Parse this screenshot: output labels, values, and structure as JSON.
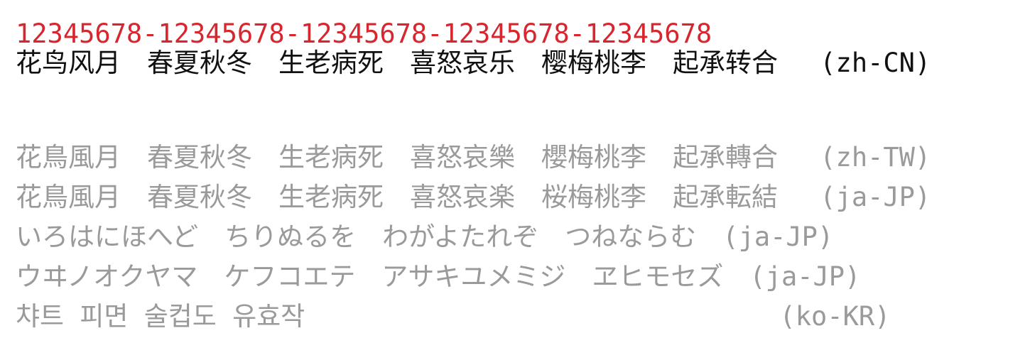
{
  "ruler": "12345678-12345678-12345678-12345678-12345678",
  "lines": [
    {
      "text": "花鸟风月　春夏秋冬　生老病死　喜怒哀乐　樱梅桃李　起承转合　 (zh-CN)"
    },
    {
      "text": "花鳥風月　春夏秋冬　生老病死　喜怒哀樂　櫻梅桃李　起承轉合　 (zh-TW)"
    },
    {
      "text": "花鳥風月　春夏秋冬　生老病死　喜怒哀楽　桜梅桃李　起承転結　 (ja-JP)"
    },
    {
      "text": "いろはにほへど　ちりぬるを　わがよたれぞ　つねならむ　(ja-JP)"
    },
    {
      "text": "ウヰノオクヤマ　ケフコエテ　アサキユメミジ　ヱヒモセズ　(ja-JP)"
    },
    {
      "text": "챠트 피면 술컵도 유효작                              (ko-KR)"
    }
  ],
  "colors": {
    "ruler": "#d7262e",
    "primary": "#111111",
    "muted": "#9a9a9a"
  }
}
